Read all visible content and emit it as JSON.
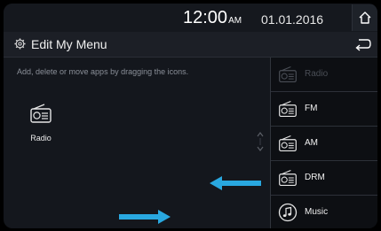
{
  "status": {
    "time": "12:00",
    "ampm": "AM",
    "date": "01.01.2016"
  },
  "header": {
    "title": "Edit My Menu"
  },
  "main": {
    "instruction": "Add, delete or move apps by dragging the icons.",
    "apps": [
      {
        "label": "Radio",
        "icon": "radio-icon"
      }
    ]
  },
  "menu": {
    "items": [
      {
        "label": "Radio",
        "icon": "radio-icon",
        "state": "disabled"
      },
      {
        "label": "FM",
        "icon": "radio-icon"
      },
      {
        "label": "AM",
        "icon": "radio-icon"
      },
      {
        "label": "DRM",
        "icon": "radio-icon"
      },
      {
        "label": "Music",
        "icon": "music-note-icon"
      }
    ]
  },
  "colors": {
    "arrow": "#29a8e0",
    "background": "#14171d",
    "list_background": "#0d0f13"
  }
}
